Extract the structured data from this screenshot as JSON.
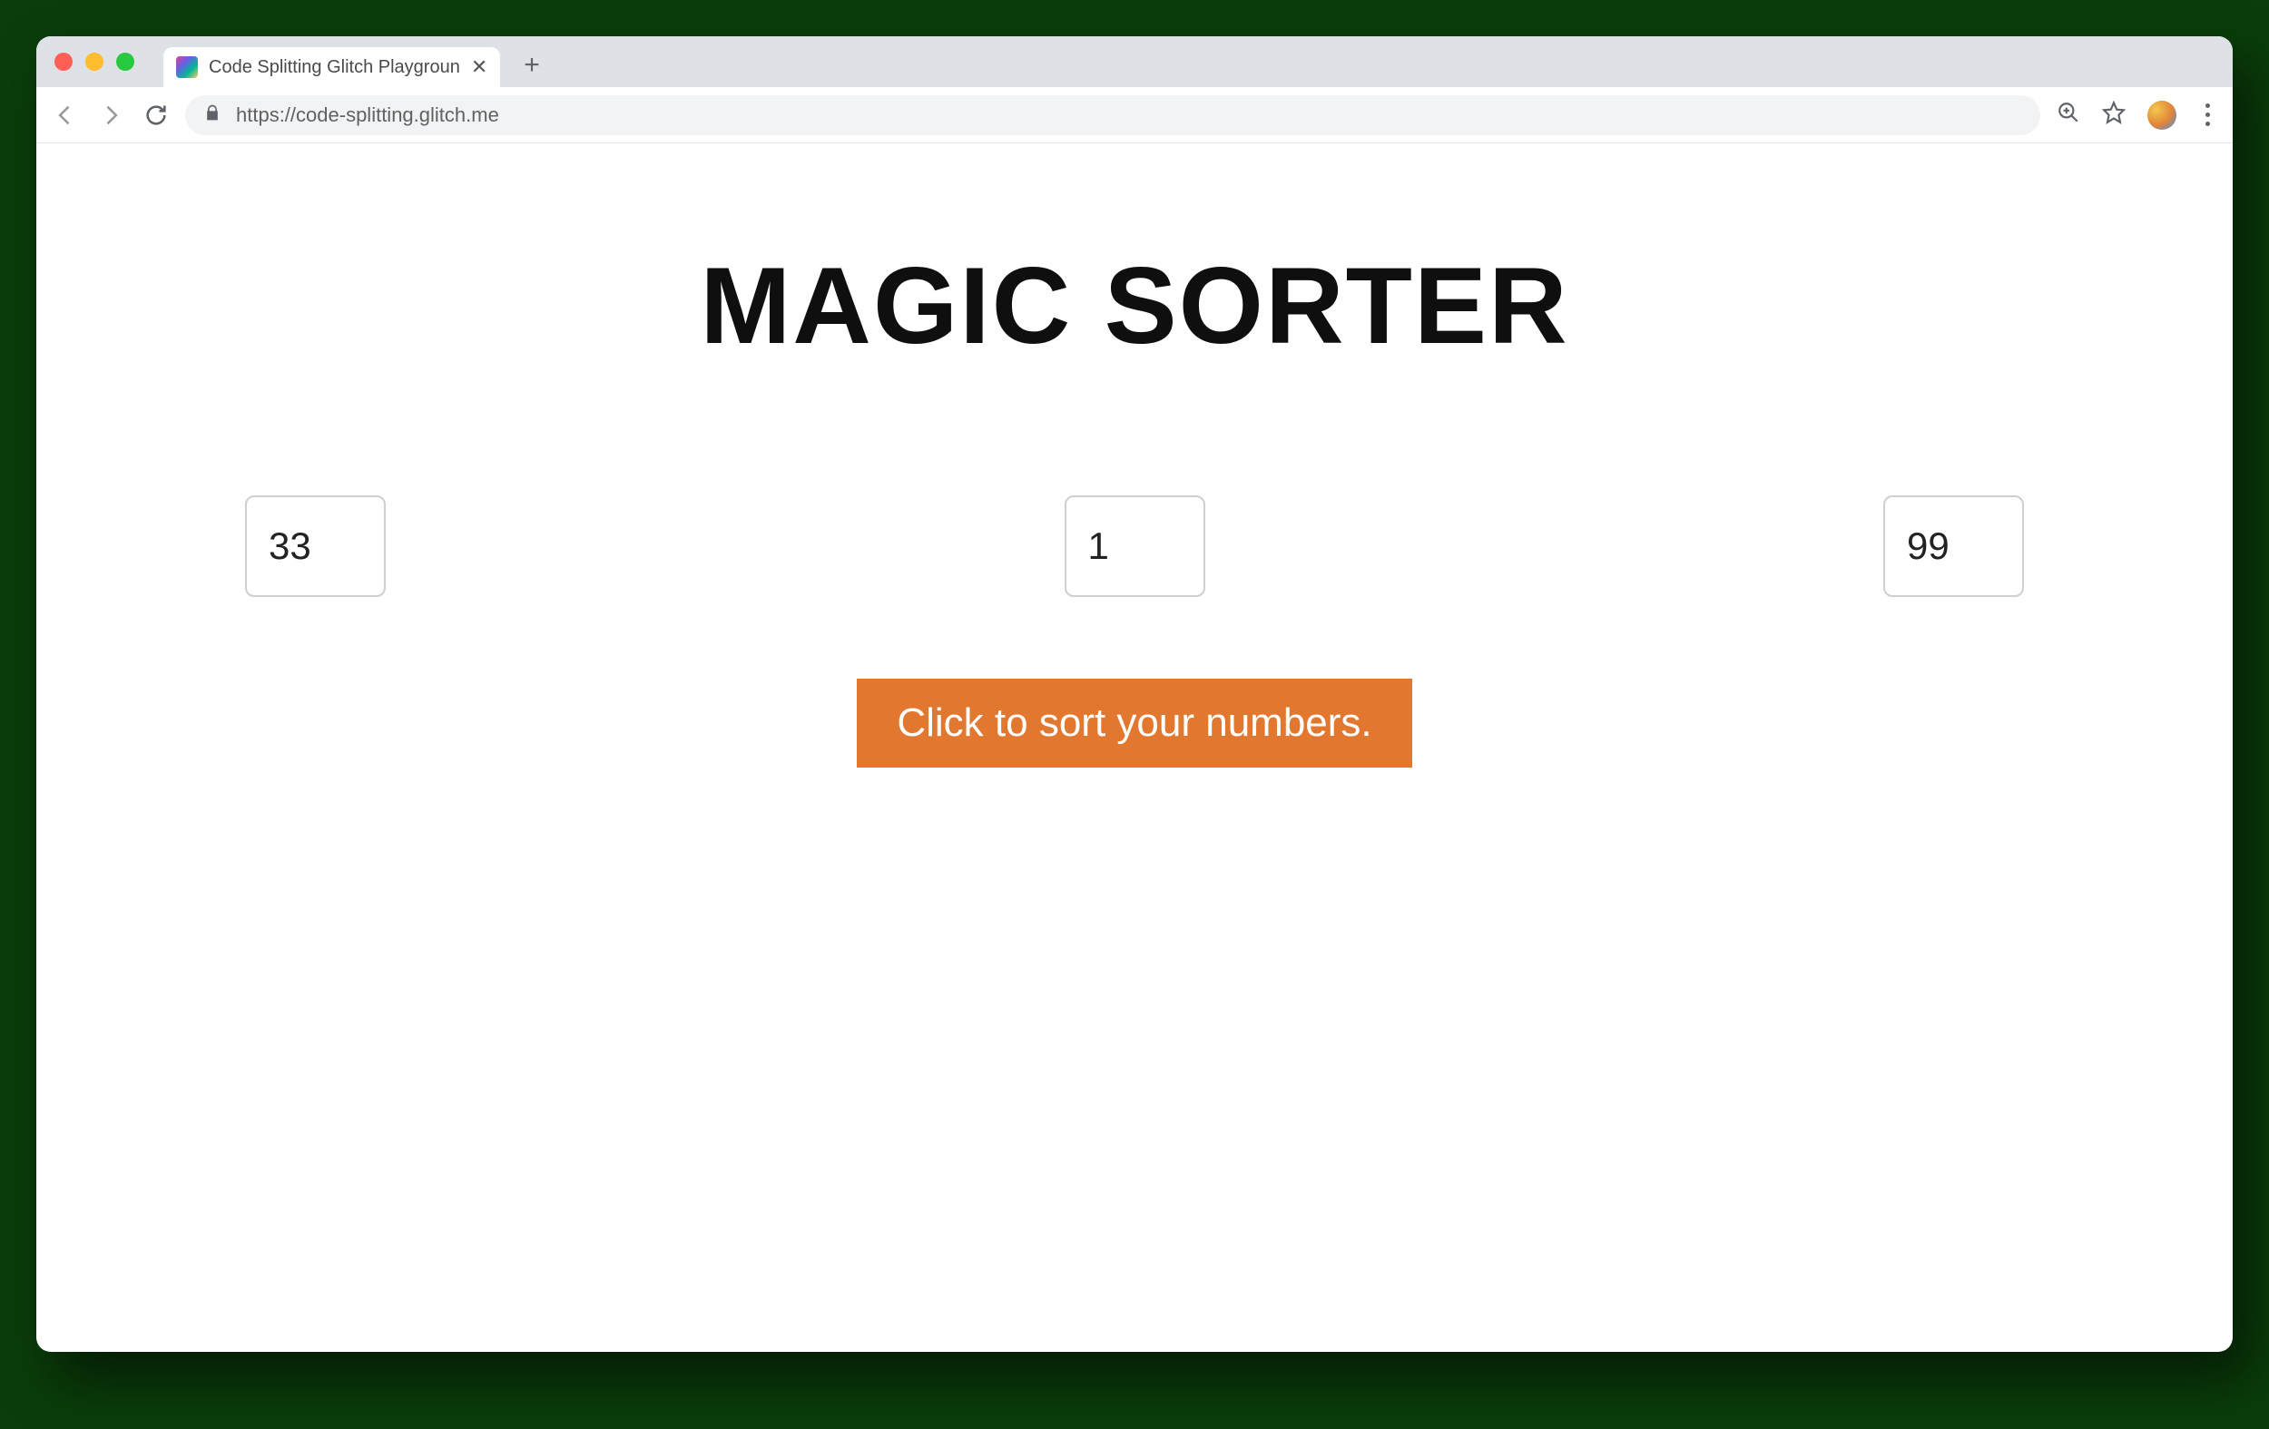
{
  "browser": {
    "tab": {
      "title": "Code Splitting Glitch Playgroun"
    },
    "url": "https://code-splitting.glitch.me"
  },
  "page": {
    "heading": "MAGIC SORTER",
    "inputs": {
      "val1": "33",
      "val2": "1",
      "val3": "99"
    },
    "button_label": "Click to sort your numbers."
  },
  "colors": {
    "button_bg": "#e27830"
  }
}
